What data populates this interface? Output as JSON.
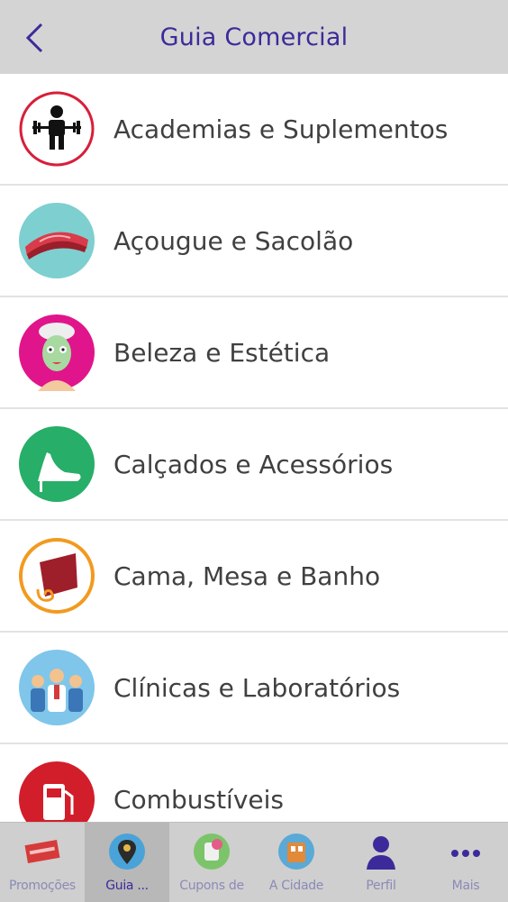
{
  "header": {
    "title": "Guia Comercial"
  },
  "categories": [
    {
      "label": "Academias e Suplementos",
      "icon": "weightlifter-icon"
    },
    {
      "label": "Açougue e Sacolão",
      "icon": "meat-steak-icon"
    },
    {
      "label": "Beleza e Estética",
      "icon": "facial-mask-icon"
    },
    {
      "label": "Calçados e Acessórios",
      "icon": "high-heel-shoe-icon"
    },
    {
      "label": "Cama, Mesa e Banho",
      "icon": "towel-icon"
    },
    {
      "label": "Clínicas e Laboratórios",
      "icon": "doctors-icon"
    },
    {
      "label": "Combustíveis",
      "icon": "fuel-pump-icon"
    }
  ],
  "tabs": [
    {
      "label": "Promoções",
      "icon": "promo-tag-icon",
      "active": false
    },
    {
      "label": "Guia ...",
      "icon": "map-pin-icon",
      "active": true
    },
    {
      "label": "Cupons de",
      "icon": "coupon-icon",
      "active": false
    },
    {
      "label": "A Cidade",
      "icon": "city-icon",
      "active": false
    },
    {
      "label": "Perfil",
      "icon": "user-icon",
      "active": false
    },
    {
      "label": "Mais",
      "icon": "more-dots-icon",
      "active": false
    }
  ],
  "colors": {
    "header_bg": "#d4d4d4",
    "title": "#3b2b9a",
    "tab_label": "#8a8ab8"
  }
}
